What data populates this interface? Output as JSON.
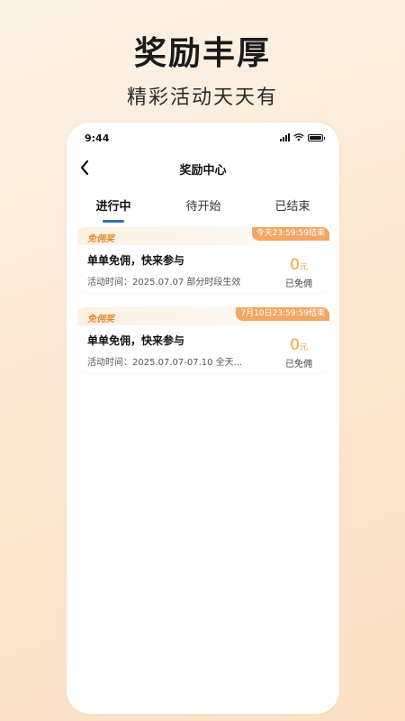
{
  "promo": {
    "headline": "奖励丰厚",
    "subline": "精彩活动天天有"
  },
  "status_bar": {
    "time": "9:44"
  },
  "nav": {
    "title": "奖励中心",
    "back_icon": "chevron-left-icon"
  },
  "tabs": [
    {
      "label": "进行中",
      "active": true
    },
    {
      "label": "待开始",
      "active": false
    },
    {
      "label": "已结束",
      "active": false
    }
  ],
  "cards": [
    {
      "tag": "免佣奖",
      "deadline": "今天23:59:59结束",
      "title": "单单免佣，快来参与",
      "time": "活动时间：2025.07.07 部分时段生效",
      "amount": "0",
      "unit": "元",
      "status": "已免佣"
    },
    {
      "tag": "免佣奖",
      "deadline": "7月10日23:59:59结束",
      "title": "单单免佣，快来参与",
      "time": "活动时间：2025.07.07-07.10 全天...",
      "amount": "0",
      "unit": "元",
      "status": "已免佣"
    }
  ],
  "colors": {
    "accent_orange": "#f2a661",
    "amount_orange": "#f0a23c",
    "tab_indicator": "#2d6cc0"
  }
}
